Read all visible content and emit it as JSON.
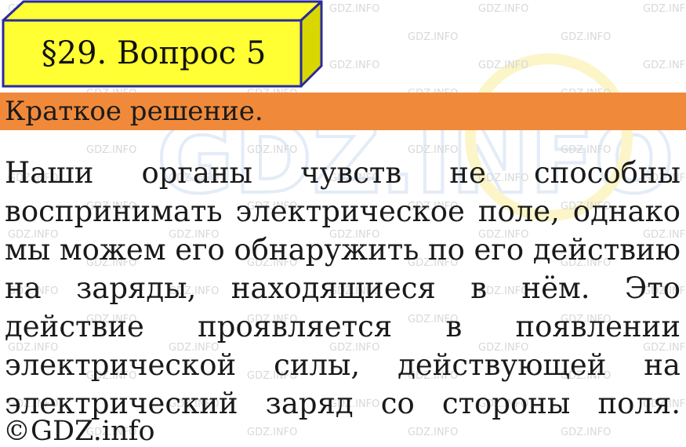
{
  "watermark": {
    "text": "GDZ.INFO",
    "logo_text": "GDZ.INFO"
  },
  "header": {
    "title": "§29. Вопрос 5"
  },
  "section": {
    "label": "Краткое решение."
  },
  "answer": {
    "lines": [
      [
        "Наши",
        "органы",
        "чувств",
        "не",
        "способны"
      ],
      [
        "воспринимать",
        "электрическое",
        "поле,",
        "однако"
      ],
      [
        "мы",
        "можем",
        "его",
        "обнаружить",
        "по",
        "его",
        "действию"
      ],
      [
        "на",
        "заряды,",
        "находящиеся",
        "в",
        "нём.",
        "Это"
      ],
      [
        "действие",
        "проявляется",
        "в",
        "появлении"
      ],
      [
        "электрической",
        "силы,",
        "действующей",
        "на"
      ],
      [
        "электрический",
        "заряд",
        "со",
        "стороны",
        "поля."
      ]
    ]
  },
  "footer": {
    "copyright": "©GDZ.info"
  },
  "colors": {
    "title_fill": "#ffff33",
    "title_side": "#d8d800",
    "title_border": "#2a2aa0",
    "band": "#f08a3a"
  }
}
